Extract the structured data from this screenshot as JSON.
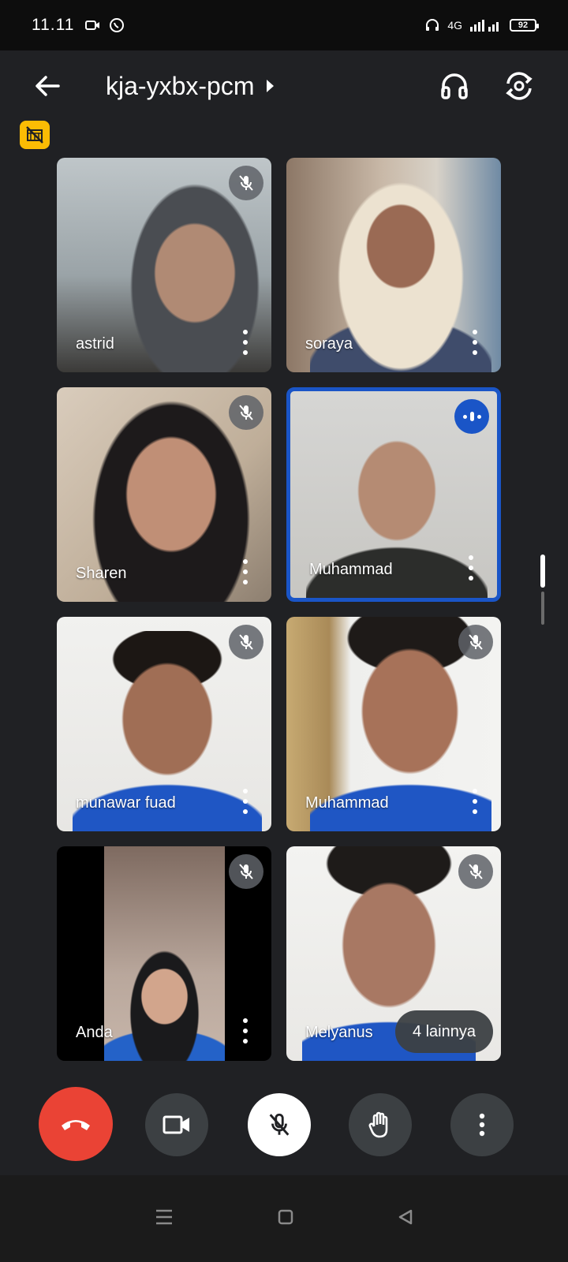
{
  "status_bar": {
    "time": "11.11",
    "network": "4G",
    "battery": "92"
  },
  "header": {
    "meeting_code": "kja-yxbx-pcm"
  },
  "tiles": [
    {
      "name": "astrid",
      "muted": true
    },
    {
      "name": "soraya",
      "muted": false
    },
    {
      "name": "Sharen",
      "muted": true
    },
    {
      "name": "Muhammad",
      "muted": false,
      "speaking": true
    },
    {
      "name": "munawar fuad",
      "muted": true
    },
    {
      "name": "Muhammad",
      "muted": true
    },
    {
      "name": "Anda",
      "muted": true
    },
    {
      "name": "Melyanus",
      "muted": true
    }
  ],
  "more_participants": "4 lainnya",
  "colors": {
    "accent": "#1a55c7",
    "end_call": "#ea4335",
    "warning": "#fbbc04",
    "background": "#202124"
  },
  "icons": [
    "back-arrow-icon",
    "play-caret-icon",
    "headphones-icon",
    "switch-camera-icon",
    "no-filter-icon",
    "mic-off-icon",
    "speaking-icon",
    "more-vert-icon",
    "end-call-icon",
    "video-icon",
    "hand-icon",
    "recents-icon",
    "home-icon",
    "back-nav-icon"
  ]
}
